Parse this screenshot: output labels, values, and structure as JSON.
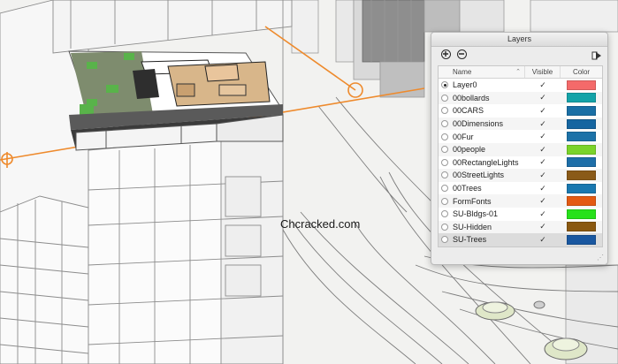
{
  "watermark": "Chcracked.com",
  "layers_panel": {
    "title": "Layers",
    "columns": {
      "name": "Name",
      "visible": "Visible",
      "color": "Color"
    },
    "add_icon": "plus-circle-icon",
    "delete_icon": "minus-circle-icon",
    "details_icon": "details-arrow-icon",
    "check_glyph": "✓",
    "rows": [
      {
        "name": "Layer0",
        "active": true,
        "visible": true,
        "color": "#f46a6a"
      },
      {
        "name": "00bollards",
        "active": false,
        "visible": true,
        "color": "#14a3a8"
      },
      {
        "name": "00CARS",
        "active": false,
        "visible": true,
        "color": "#1a6fa5"
      },
      {
        "name": "00Dimensions",
        "active": false,
        "visible": true,
        "color": "#1565a0"
      },
      {
        "name": "00Fur",
        "active": false,
        "visible": true,
        "color": "#1c72a8"
      },
      {
        "name": "00people",
        "active": false,
        "visible": true,
        "color": "#7ad32a"
      },
      {
        "name": "00RectangleLights",
        "active": false,
        "visible": true,
        "color": "#1d6ea8"
      },
      {
        "name": "00StreetLights",
        "active": false,
        "visible": true,
        "color": "#8a5a18"
      },
      {
        "name": "00Trees",
        "active": false,
        "visible": true,
        "color": "#1978b0"
      },
      {
        "name": "FormFonts",
        "active": false,
        "visible": true,
        "color": "#e35a12"
      },
      {
        "name": "SU-Bldgs-01",
        "active": false,
        "visible": true,
        "color": "#27e11b"
      },
      {
        "name": "SU-Hidden",
        "active": false,
        "visible": true,
        "color": "#8a5810"
      },
      {
        "name": "SU-Trees",
        "active": false,
        "visible": true,
        "color": "#1957a0",
        "selected": true
      }
    ]
  }
}
